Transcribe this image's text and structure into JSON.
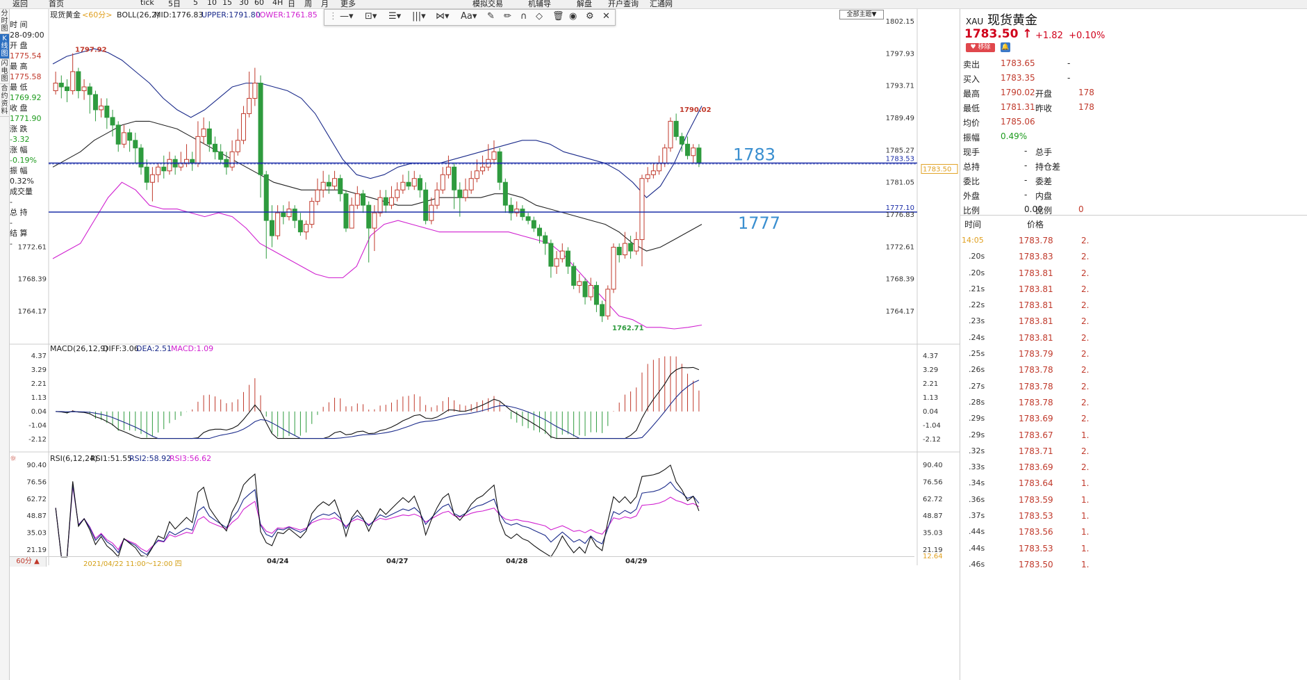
{
  "topbar": {
    "items": [
      "返回",
      "首页",
      "",
      "",
      "tick",
      "5日",
      "5",
      "10",
      "15",
      "30",
      "60",
      "4H",
      "日",
      "周",
      "月",
      "更多",
      "",
      "",
      "",
      "模拟交易",
      "机辅导",
      "解盘",
      "开户查询",
      "汇通网"
    ]
  },
  "left_tabs": [
    "分时图",
    "K线图",
    "闪电图",
    "合约资料"
  ],
  "info": {
    "time_label": "时 间",
    "time_val": "28-09:00",
    "open_label": "开 盘",
    "open_val": "1775.54",
    "high_label": "最 高",
    "high_val": "1775.58",
    "low_label": "最 低",
    "low_val": "1769.92",
    "close_label": "收 盘",
    "close_val": "1771.90",
    "chg_label": "涨 跌",
    "chg_val": "-3.32",
    "pct_label": "涨 幅",
    "pct_val": "-0.19%",
    "amp_label": "振 幅",
    "amp_val": "0.32%",
    "vol_label": "成交量",
    "vol_val": "-",
    "oi_label": "总 持",
    "oi_val": "-",
    "settle_label": "结 算",
    "settle_val": "-"
  },
  "main_chart": {
    "title": "现货黄金",
    "period": "<60分>",
    "boll_label": "BOLL(26,2)",
    "mid": "MID:1776.83",
    "upper": "UPPER:1791.80",
    "lower": "LOWER:1761.85",
    "yticks": [
      "1802.15",
      "1797.93",
      "1793.71",
      "1789.49",
      "1785.27",
      "1781.05",
      "1776.83",
      "1772.61",
      "1768.39",
      "1764.17"
    ],
    "left_yticks": [
      "1772.61",
      "1768.39",
      "1764.17"
    ],
    "high_label": "1797.92",
    "high_label2": "1790.02",
    "low_label": "1762.71",
    "line_1783_label": "1783",
    "line_1783_price": "1783.53",
    "line_1777_label": "1777",
    "line_1777_price": "1777.10",
    "cur_price_tag": "1783.50"
  },
  "macd": {
    "title": "MACD(26,12,9)",
    "diff": "DIFF:3.06",
    "dea": "DEA:2.51",
    "macd": "MACD:1.09",
    "yticks": [
      "4.37",
      "3.29",
      "2.21",
      "1.13",
      "0.04",
      "-1.04",
      "-2.12"
    ]
  },
  "rsi": {
    "title": "RSI(6,12,24)",
    "rsi1": "RSI1:51.55",
    "rsi2": "RSI2:58.92",
    "rsi3": "RSI3:56.62",
    "yticks": [
      "90.40",
      "76.56",
      "62.72",
      "48.87",
      "35.03",
      "21.19"
    ],
    "extra_right": "12.64"
  },
  "xaxis": {
    "period_btn": "60分 ▲",
    "range": "2021/04/22 11:00～12:00 四",
    "dates": [
      "04/24",
      "04/27",
      "04/28",
      "04/29"
    ]
  },
  "toolbar": {
    "theme_btn": "全部主题▼"
  },
  "right_panel": {
    "code": "XAU",
    "name": "现货黄金",
    "price": "1783.50",
    "arrow": "↑",
    "change": "+1.82",
    "pct": "+0.10%",
    "remove_btn": "移除",
    "rows": [
      {
        "l1": "卖出",
        "v1": "1783.65",
        "l2": "-",
        "v2": ""
      },
      {
        "l1": "买入",
        "v1": "1783.35",
        "l2": "-",
        "v2": ""
      },
      {
        "l1": "最高",
        "v1": "1790.02",
        "l2": "开盘",
        "v2": "178"
      },
      {
        "l1": "最低",
        "v1": "1781.31",
        "l2": "昨收",
        "v2": "178"
      },
      {
        "l1": "均价",
        "v1": "1785.06",
        "l2": "",
        "v2": ""
      },
      {
        "l1": "振幅",
        "v1": "0.49%",
        "l2": "",
        "v2": ""
      },
      {
        "l1": "现手",
        "v1": "-",
        "l2": "总手",
        "v2": ""
      },
      {
        "l1": "总持",
        "v1": "-",
        "l2": "持仓差",
        "v2": ""
      },
      {
        "l1": "委比",
        "v1": "-",
        "l2": "委差",
        "v2": ""
      },
      {
        "l1": "外盘",
        "v1": "-",
        "l2": "内盘",
        "v2": ""
      },
      {
        "l1": "比例",
        "v1": "0.00",
        "l2": "比例",
        "v2": "0"
      }
    ],
    "tick_header": [
      "时间",
      "价格"
    ],
    "ticks": [
      {
        "t": "14:05",
        "p": "1783.78",
        "v": "2."
      },
      {
        "t": ".20s",
        "p": "1783.83",
        "v": "2."
      },
      {
        "t": ".20s",
        "p": "1783.81",
        "v": "2."
      },
      {
        "t": ".21s",
        "p": "1783.81",
        "v": "2."
      },
      {
        "t": ".22s",
        "p": "1783.81",
        "v": "2."
      },
      {
        "t": ".23s",
        "p": "1783.81",
        "v": "2."
      },
      {
        "t": ".24s",
        "p": "1783.81",
        "v": "2."
      },
      {
        "t": ".25s",
        "p": "1783.79",
        "v": "2."
      },
      {
        "t": ".26s",
        "p": "1783.78",
        "v": "2."
      },
      {
        "t": ".27s",
        "p": "1783.78",
        "v": "2."
      },
      {
        "t": ".28s",
        "p": "1783.78",
        "v": "2."
      },
      {
        "t": ".29s",
        "p": "1783.69",
        "v": "2."
      },
      {
        "t": ".29s",
        "p": "1783.67",
        "v": "1."
      },
      {
        "t": ".32s",
        "p": "1783.71",
        "v": "2."
      },
      {
        "t": ".33s",
        "p": "1783.69",
        "v": "2."
      },
      {
        "t": ".34s",
        "p": "1783.64",
        "v": "1."
      },
      {
        "t": ".36s",
        "p": "1783.59",
        "v": "1."
      },
      {
        "t": ".37s",
        "p": "1783.53",
        "v": "1."
      },
      {
        "t": ".44s",
        "p": "1783.56",
        "v": "1."
      },
      {
        "t": ".44s",
        "p": "1783.53",
        "v": "1."
      },
      {
        "t": ".46s",
        "p": "1783.50",
        "v": "1."
      }
    ]
  },
  "chart_data": {
    "type": "line",
    "title": "现货黄金 <60分>",
    "ylim": [
      1762.0,
      1803.0
    ],
    "candles": [
      [
        1793.0,
        1794.0,
        1795.5,
        1792.5
      ],
      [
        1794.0,
        1793.5,
        1795.0,
        1792.0
      ],
      [
        1793.5,
        1793.0,
        1794.5,
        1791.5
      ],
      [
        1793.0,
        1795.5,
        1797.9,
        1792.5
      ],
      [
        1795.5,
        1793.0,
        1796.0,
        1792.0
      ],
      [
        1793.0,
        1793.5,
        1794.5,
        1791.8
      ],
      [
        1793.5,
        1792.5,
        1794.0,
        1790.0
      ],
      [
        1792.5,
        1790.5,
        1793.0,
        1789.0
      ],
      [
        1790.5,
        1791.0,
        1792.0,
        1789.5
      ],
      [
        1791.0,
        1789.5,
        1792.0,
        1788.0
      ],
      [
        1789.5,
        1788.5,
        1790.5,
        1787.0
      ],
      [
        1788.5,
        1786.0,
        1789.0,
        1785.0
      ],
      [
        1786.0,
        1787.5,
        1788.5,
        1785.5
      ],
      [
        1787.5,
        1786.5,
        1788.0,
        1785.0
      ],
      [
        1786.5,
        1785.5,
        1787.5,
        1783.5
      ],
      [
        1785.5,
        1783.0,
        1786.0,
        1782.0
      ],
      [
        1783.0,
        1781.0,
        1784.0,
        1780.0
      ],
      [
        1781.0,
        1782.0,
        1783.0,
        1778.5
      ],
      [
        1782.0,
        1783.0,
        1783.5,
        1781.0
      ],
      [
        1783.0,
        1782.5,
        1784.5,
        1781.5
      ],
      [
        1782.5,
        1784.0,
        1785.0,
        1782.0
      ],
      [
        1784.0,
        1783.0,
        1784.5,
        1782.0
      ],
      [
        1783.0,
        1783.5,
        1785.0,
        1782.5
      ],
      [
        1783.5,
        1784.0,
        1786.0,
        1783.0
      ],
      [
        1784.0,
        1783.5,
        1785.0,
        1782.5
      ],
      [
        1783.5,
        1787.0,
        1789.0,
        1783.0
      ],
      [
        1787.0,
        1788.0,
        1789.5,
        1786.0
      ],
      [
        1788.0,
        1786.0,
        1789.0,
        1785.0
      ],
      [
        1786.0,
        1785.0,
        1787.0,
        1784.0
      ],
      [
        1785.0,
        1784.0,
        1786.0,
        1783.5
      ],
      [
        1784.0,
        1783.0,
        1785.0,
        1782.0
      ],
      [
        1783.0,
        1785.0,
        1786.5,
        1782.5
      ],
      [
        1785.0,
        1786.5,
        1788.0,
        1784.5
      ],
      [
        1786.5,
        1790.0,
        1791.0,
        1786.0
      ],
      [
        1790.0,
        1792.0,
        1795.5,
        1789.5
      ],
      [
        1792.0,
        1794.0,
        1796.0,
        1791.0
      ],
      [
        1794.0,
        1782.0,
        1795.0,
        1779.0
      ],
      [
        1782.0,
        1776.0,
        1782.5,
        1771.0
      ],
      [
        1776.0,
        1774.0,
        1778.0,
        1772.5
      ],
      [
        1774.0,
        1777.0,
        1778.0,
        1773.5
      ],
      [
        1777.0,
        1776.5,
        1778.0,
        1775.5
      ],
      [
        1776.5,
        1777.5,
        1778.5,
        1776.0
      ],
      [
        1777.5,
        1776.0,
        1778.0,
        1775.0
      ],
      [
        1776.0,
        1774.5,
        1777.0,
        1774.0
      ],
      [
        1774.5,
        1775.5,
        1776.0,
        1773.5
      ],
      [
        1775.5,
        1778.5,
        1779.0,
        1775.0
      ],
      [
        1778.5,
        1780.0,
        1781.5,
        1778.0
      ],
      [
        1780.0,
        1781.0,
        1782.5,
        1779.0
      ],
      [
        1781.0,
        1780.5,
        1782.0,
        1779.5
      ],
      [
        1780.5,
        1781.5,
        1782.5,
        1780.0
      ],
      [
        1781.5,
        1779.5,
        1782.0,
        1778.5
      ],
      [
        1779.5,
        1775.0,
        1780.0,
        1774.5
      ],
      [
        1775.0,
        1778.0,
        1779.0,
        1775.0
      ],
      [
        1778.0,
        1779.5,
        1780.5,
        1777.5
      ],
      [
        1779.5,
        1778.0,
        1780.0,
        1777.0
      ],
      [
        1778.0,
        1775.0,
        1778.5,
        1770.5
      ],
      [
        1775.0,
        1777.0,
        1778.0,
        1772.0
      ],
      [
        1777.0,
        1779.0,
        1780.0,
        1776.5
      ],
      [
        1779.0,
        1778.0,
        1780.0,
        1777.0
      ],
      [
        1778.0,
        1779.0,
        1780.5,
        1777.5
      ],
      [
        1779.0,
        1780.0,
        1781.0,
        1778.5
      ],
      [
        1780.0,
        1781.0,
        1782.0,
        1779.5
      ],
      [
        1781.0,
        1780.5,
        1782.5,
        1780.0
      ],
      [
        1780.5,
        1781.5,
        1782.5,
        1780.0
      ],
      [
        1781.5,
        1780.0,
        1782.0,
        1779.0
      ],
      [
        1780.0,
        1776.0,
        1781.0,
        1775.5
      ],
      [
        1776.0,
        1778.0,
        1779.0,
        1775.5
      ],
      [
        1778.0,
        1780.0,
        1781.0,
        1777.5
      ],
      [
        1780.0,
        1782.0,
        1783.0,
        1779.5
      ],
      [
        1782.0,
        1783.0,
        1784.5,
        1781.5
      ],
      [
        1783.0,
        1780.0,
        1783.5,
        1777.5
      ],
      [
        1780.0,
        1779.0,
        1781.0,
        1776.5
      ],
      [
        1779.0,
        1780.0,
        1781.5,
        1778.5
      ],
      [
        1780.0,
        1781.5,
        1782.5,
        1779.5
      ],
      [
        1781.5,
        1782.5,
        1784.0,
        1781.0
      ],
      [
        1782.5,
        1783.0,
        1784.5,
        1782.0
      ],
      [
        1783.0,
        1784.0,
        1786.0,
        1782.5
      ],
      [
        1784.0,
        1785.0,
        1786.5,
        1783.5
      ],
      [
        1785.0,
        1781.0,
        1785.5,
        1780.0
      ],
      [
        1781.0,
        1778.0,
        1781.5,
        1777.0
      ],
      [
        1778.0,
        1777.0,
        1779.0,
        1776.0
      ],
      [
        1777.0,
        1777.5,
        1778.5,
        1776.5
      ],
      [
        1777.5,
        1776.5,
        1778.0,
        1776.0
      ],
      [
        1776.5,
        1776.0,
        1777.0,
        1775.5
      ],
      [
        1776.0,
        1775.0,
        1776.5,
        1774.5
      ],
      [
        1775.0,
        1774.0,
        1775.5,
        1773.0
      ],
      [
        1774.0,
        1773.0,
        1774.5,
        1771.5
      ],
      [
        1773.0,
        1770.0,
        1773.5,
        1768.5
      ],
      [
        1770.0,
        1771.0,
        1772.0,
        1769.0
      ],
      [
        1771.0,
        1772.0,
        1773.0,
        1770.5
      ],
      [
        1772.0,
        1770.0,
        1772.5,
        1769.0
      ],
      [
        1770.0,
        1767.5,
        1770.5,
        1767.0
      ],
      [
        1767.5,
        1768.0,
        1769.0,
        1766.5
      ],
      [
        1768.0,
        1766.0,
        1768.5,
        1765.0
      ],
      [
        1766.0,
        1767.5,
        1768.5,
        1765.5
      ],
      [
        1767.5,
        1765.0,
        1768.0,
        1764.0
      ],
      [
        1765.0,
        1763.5,
        1765.5,
        1762.7
      ],
      [
        1763.5,
        1767.0,
        1767.5,
        1763.0
      ],
      [
        1767.0,
        1772.5,
        1773.0,
        1766.5
      ],
      [
        1772.5,
        1771.5,
        1773.0,
        1770.5
      ],
      [
        1771.5,
        1773.0,
        1774.5,
        1771.0
      ],
      [
        1773.0,
        1772.0,
        1774.0,
        1771.0
      ],
      [
        1772.0,
        1773.5,
        1774.5,
        1771.5
      ],
      [
        1773.5,
        1781.5,
        1782.0,
        1770.0
      ],
      [
        1781.5,
        1782.0,
        1783.0,
        1781.0
      ],
      [
        1782.0,
        1782.5,
        1783.5,
        1781.5
      ],
      [
        1782.5,
        1783.5,
        1784.5,
        1782.0
      ],
      [
        1783.5,
        1785.5,
        1786.0,
        1783.0
      ],
      [
        1785.5,
        1789.0,
        1789.5,
        1785.0
      ],
      [
        1789.0,
        1787.0,
        1790.0,
        1786.5
      ],
      [
        1787.0,
        1786.0,
        1787.5,
        1785.0
      ],
      [
        1786.0,
        1784.5,
        1787.0,
        1784.0
      ],
      [
        1784.5,
        1785.5,
        1786.0,
        1783.5
      ],
      [
        1785.5,
        1783.5,
        1786.0,
        1783.0
      ]
    ],
    "mid": [
      1783,
      1784,
      1785,
      1786.5,
      1787.5,
      1788.5,
      1789,
      1789,
      1788.5,
      1788,
      1787,
      1786,
      1785,
      1784,
      1783,
      1782,
      1781,
      1780.5,
      1780,
      1780,
      1780,
      1780,
      1779.5,
      1779,
      1778.5,
      1778,
      1778,
      1778.5,
      1779,
      1779,
      1779,
      1779,
      1779.5,
      1779.5,
      1779,
      1778,
      1777.5,
      1777,
      1776.5,
      1776,
      1775.5,
      1774.5,
      1773,
      1772,
      1772.5,
      1773.5,
      1774.5,
      1775.5
    ],
    "upper": [
      1796.5,
      1797.5,
      1798,
      1798.5,
      1798,
      1797,
      1795.5,
      1794,
      1792,
      1790.5,
      1789.5,
      1790.5,
      1792,
      1793.5,
      1794,
      1794,
      1793.5,
      1793,
      1792,
      1790,
      1787,
      1784,
      1782,
      1781.5,
      1782,
      1783,
      1783.5,
      1783.5,
      1783.5,
      1784,
      1784.5,
      1785,
      1785.5,
      1786,
      1786.5,
      1786.5,
      1786,
      1785,
      1784.5,
      1784,
      1783.5,
      1782.5,
      1781,
      1779,
      1780.5,
      1783.5,
      1787.5,
      1791
    ],
    "lower": [
      1771,
      1772,
      1773,
      1776,
      1779,
      1781,
      1780,
      1778,
      1777.5,
      1777.5,
      1777,
      1776.5,
      1777,
      1776.5,
      1775,
      1773,
      1772,
      1771,
      1770,
      1769,
      1768.5,
      1768.5,
      1770,
      1774,
      1775.5,
      1776,
      1775.5,
      1775,
      1774.5,
      1774.5,
      1774.5,
      1774.5,
      1774.5,
      1774.5,
      1774,
      1773.5,
      1773,
      1771.5,
      1769.5,
      1767.5,
      1765.5,
      1763.5,
      1763,
      1762,
      1762,
      1761.8,
      1762,
      1762.3
    ]
  }
}
